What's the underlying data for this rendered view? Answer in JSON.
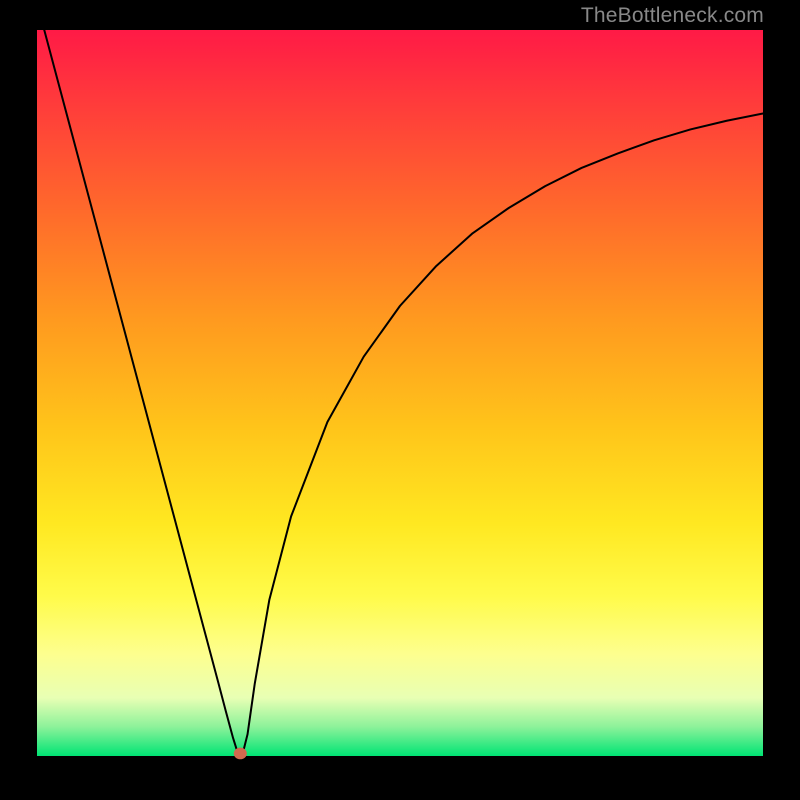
{
  "watermark": {
    "text": "TheBottleneck.com"
  },
  "chart_data": {
    "type": "line",
    "title": "",
    "xlabel": "",
    "ylabel": "",
    "xlim": [
      0,
      100
    ],
    "ylim": [
      0,
      100
    ],
    "grid": false,
    "legend": false,
    "curve": {
      "color": "#000000",
      "width": 2.0,
      "x": [
        1,
        3,
        5,
        7,
        9,
        11,
        13,
        15,
        17,
        19,
        21,
        23,
        25,
        26,
        27,
        27.5,
        28,
        28.5,
        29,
        29.5,
        30,
        32,
        35,
        40,
        45,
        50,
        55,
        60,
        65,
        70,
        75,
        80,
        85,
        90,
        95,
        100
      ],
      "y": [
        100,
        92.5,
        85,
        77.5,
        70,
        62.5,
        55,
        47.5,
        40,
        32.5,
        25,
        17.5,
        10,
        6.2,
        2.5,
        0.9,
        0.0,
        1.0,
        3.0,
        6.5,
        10.0,
        21.5,
        33.0,
        46.0,
        55.0,
        62.0,
        67.5,
        72.0,
        75.5,
        78.5,
        81.0,
        83.0,
        84.8,
        86.3,
        87.5,
        88.5
      ]
    },
    "marker": {
      "x": 28.0,
      "y": 0.35,
      "rx": 0.9,
      "ry": 0.8,
      "color": "#d2694f"
    }
  }
}
